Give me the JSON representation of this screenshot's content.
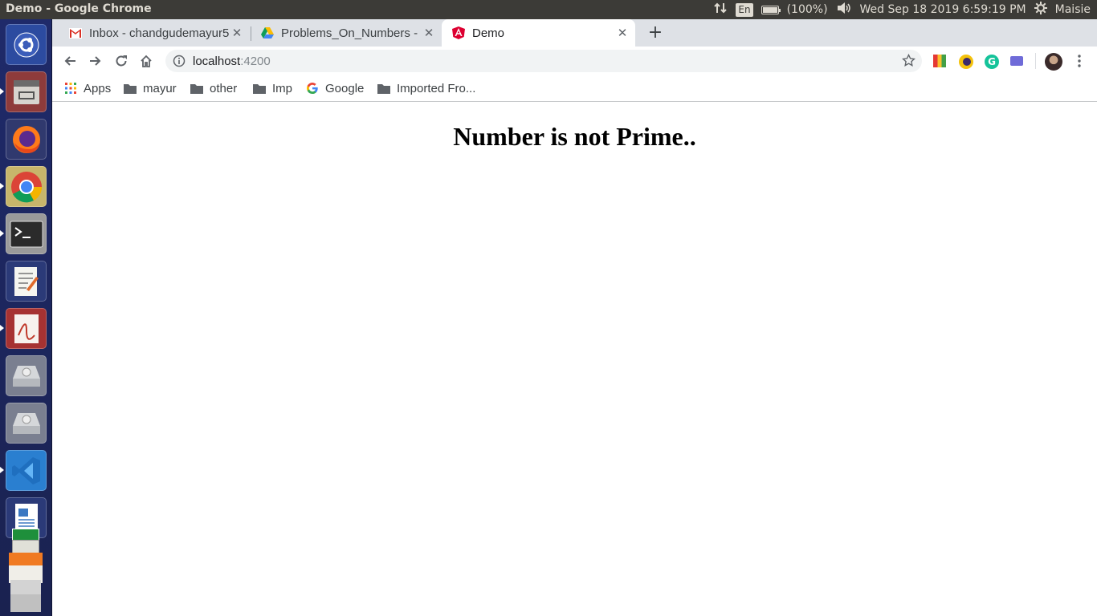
{
  "system": {
    "window_title": "Demo - Google Chrome",
    "language": "En",
    "battery": "(100%)",
    "datetime": "Wed Sep 18 2019  6:59:19 PM",
    "user": "Maisie"
  },
  "launcher": {
    "items": [
      {
        "name": "ubuntu-dash-icon"
      },
      {
        "name": "files-icon"
      },
      {
        "name": "firefox-icon"
      },
      {
        "name": "chrome-icon"
      },
      {
        "name": "terminal-icon"
      },
      {
        "name": "text-editor-icon"
      },
      {
        "name": "document-viewer-icon"
      },
      {
        "name": "disk-drive-icon"
      },
      {
        "name": "disk-drive-icon"
      },
      {
        "name": "vscode-icon"
      },
      {
        "name": "libreoffice-writer-icon"
      }
    ]
  },
  "browser": {
    "tabs": [
      {
        "label": "Inbox - chandgudemayur5",
        "icon": "gmail-icon",
        "active": false
      },
      {
        "label": "Problems_On_Numbers - G",
        "icon": "google-drive-icon",
        "active": false
      },
      {
        "label": "Demo",
        "icon": "angular-icon",
        "active": true
      }
    ],
    "address": {
      "host": "localhost",
      "port": ":4200"
    },
    "bookmarks": [
      {
        "label": "Apps",
        "icon": "apps-grid-icon"
      },
      {
        "label": "mayur",
        "icon": "folder-icon"
      },
      {
        "label": "other",
        "icon": "folder-icon"
      },
      {
        "label": "Imp",
        "icon": "folder-icon"
      },
      {
        "label": "Google",
        "icon": "google-icon"
      },
      {
        "label": "Imported Fro...",
        "icon": "folder-icon"
      }
    ],
    "extensions": [
      {
        "name": "color-palette-extension-icon",
        "color": "#e53935"
      },
      {
        "name": "moon-extension-icon",
        "color": "#f4c20d"
      },
      {
        "name": "grammarly-extension-icon",
        "color": "#15c39a"
      },
      {
        "name": "keyboard-extension-icon",
        "color": "#6f6bd8"
      }
    ]
  },
  "page": {
    "heading": "Number is not Prime.."
  }
}
